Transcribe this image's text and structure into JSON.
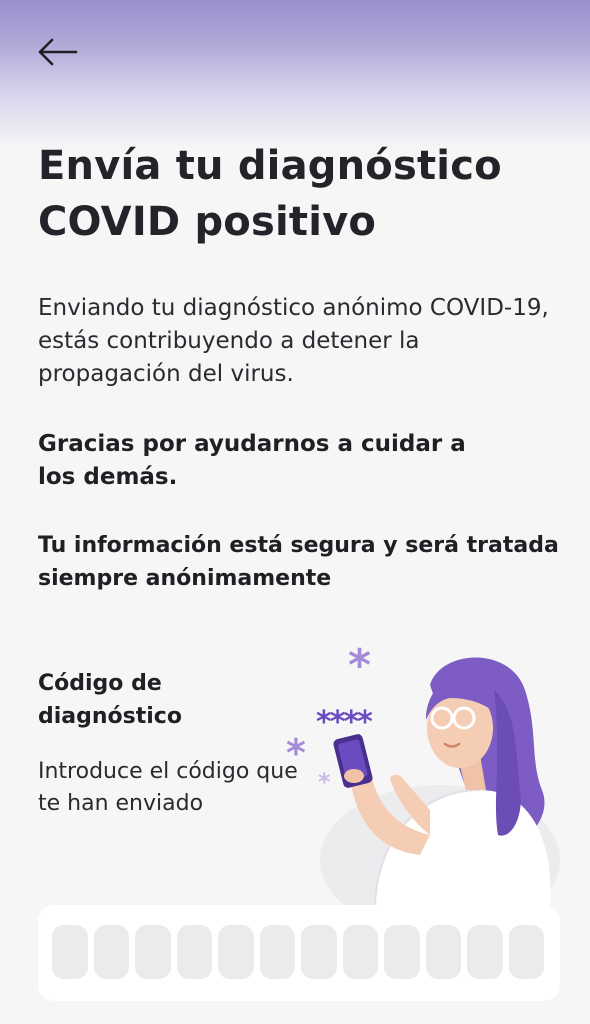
{
  "header": {
    "back_icon": "arrow-left-icon"
  },
  "title": "Envía tu diagnóstico COVID positivo",
  "intro": "Enviando tu diagnóstico anónimo COVID-19, estás contribuyendo a detener la propagación del virus.",
  "thanks": "Gracias por ayudarnos a cuidar a los demás.",
  "secure": "Tu información está segura y será tratada siempre anónimamente",
  "code_section": {
    "title": "Código de diagnóstico",
    "description": "Introduce el código que te han enviado"
  },
  "illustration": {
    "masked_code": "****",
    "icon": "woman-with-phone-illustration"
  },
  "code_input": {
    "cell_count": 12,
    "cells": [
      "",
      "",
      "",
      "",
      "",
      "",
      "",
      "",
      "",
      "",
      "",
      ""
    ]
  },
  "colors": {
    "accent": "#7b61c9",
    "header_gradient": "#9a8fcc",
    "background": "#f7f6f6",
    "text": "#232329",
    "cell": "#ebeaec"
  }
}
